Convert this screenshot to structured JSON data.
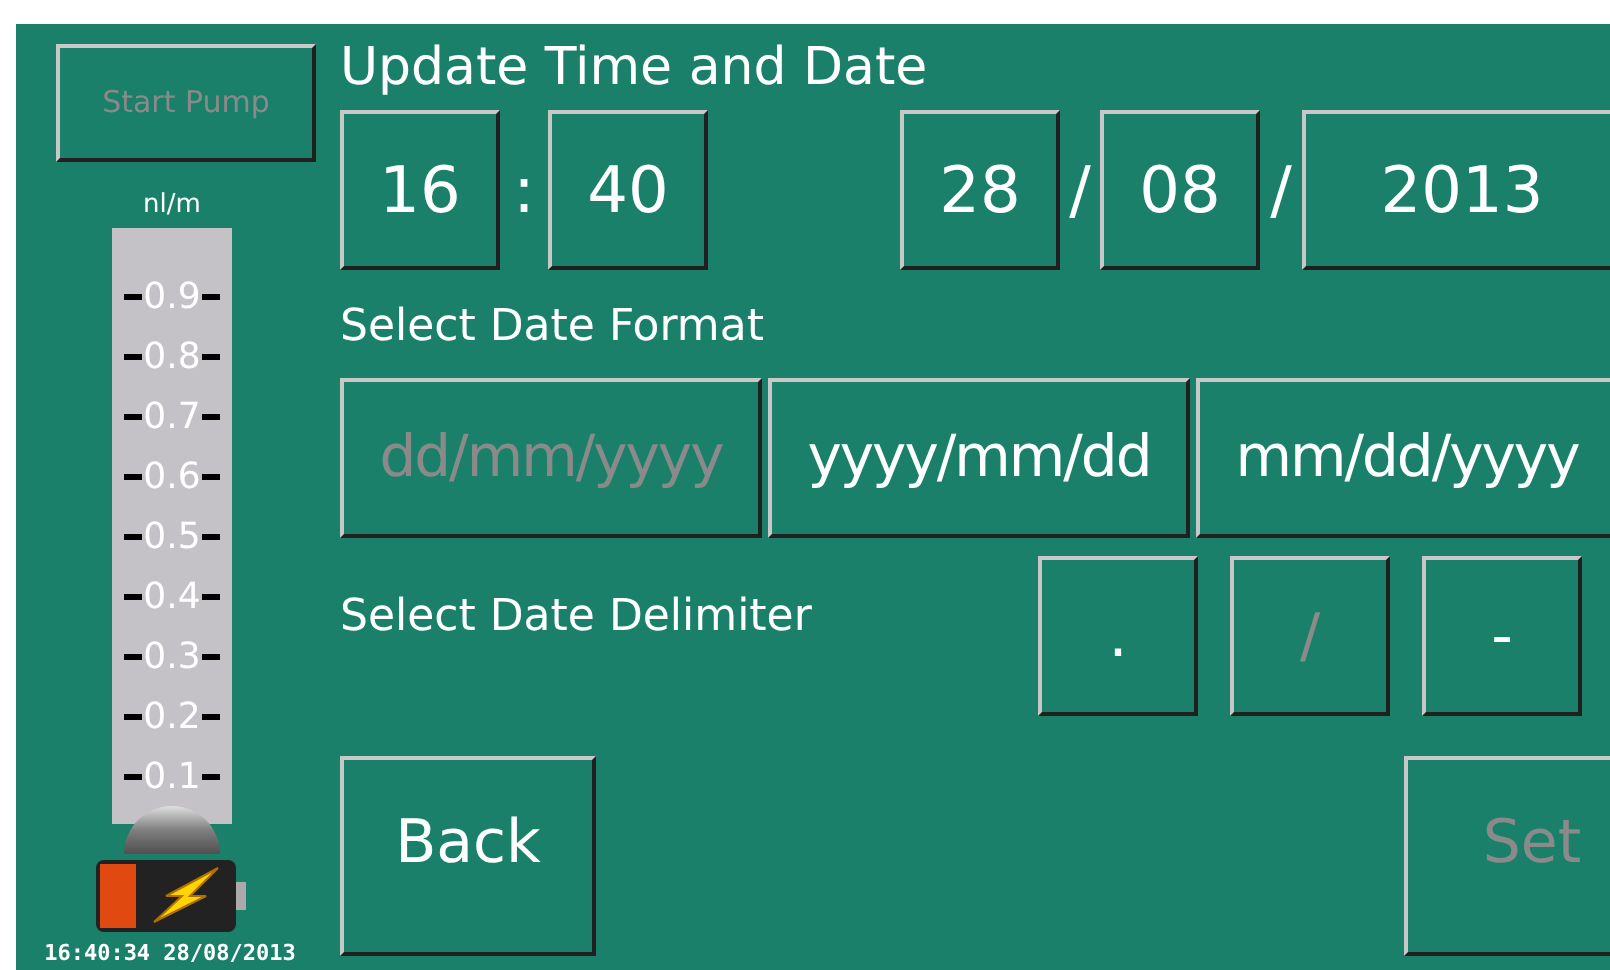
{
  "sidebar": {
    "start_button": {
      "label": "Start Pump",
      "disabled": true
    },
    "gauge": {
      "unit": "nl/m",
      "ticks": [
        "0.9",
        "0.8",
        "0.7",
        "0.6",
        "0.5",
        "0.4",
        "0.3",
        "0.2",
        "0.1"
      ],
      "level": 0.04
    },
    "timestamp": "16:40:34 28/08/2013"
  },
  "title": "Update Time and Date",
  "time": {
    "hours": "16",
    "separator": ":",
    "minutes": "40"
  },
  "date": {
    "day": "28",
    "separator_1": "/",
    "month": "08",
    "separator_2": "/",
    "year": "2013"
  },
  "format_section": {
    "label": "Select Date Format",
    "options": [
      {
        "label": "dd/mm/yyyy",
        "selected": true
      },
      {
        "label": "yyyy/mm/dd",
        "selected": false
      },
      {
        "label": "mm/dd/yyyy",
        "selected": false
      }
    ]
  },
  "delimiter_section": {
    "label": "Select Date Delimiter",
    "options": [
      {
        "label": ".",
        "selected": false
      },
      {
        "label": "/",
        "selected": true
      },
      {
        "label": "-",
        "selected": false
      }
    ]
  },
  "buttons": [
    {
      "label": "Back",
      "disabled": false
    },
    {
      "label": "Set",
      "disabled": true
    }
  ]
}
